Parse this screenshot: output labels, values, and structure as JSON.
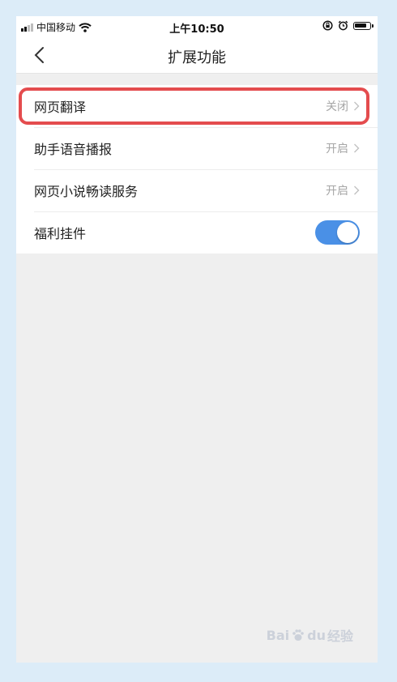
{
  "status_bar": {
    "carrier": "中国移动",
    "time": "上午10:50",
    "icons": [
      "signal-icon",
      "wifi-icon",
      "rotation-lock-icon",
      "alarm-icon",
      "battery-icon"
    ]
  },
  "nav": {
    "title": "扩展功能",
    "back_icon": "chevron-left-icon"
  },
  "settings": [
    {
      "label": "网页翻译",
      "value": "关闭",
      "type": "link"
    },
    {
      "label": "助手语音播报",
      "value": "开启",
      "type": "link"
    },
    {
      "label": "网页小说畅读服务",
      "value": "开启",
      "type": "link"
    },
    {
      "label": "福利挂件",
      "type": "toggle",
      "on": true
    }
  ],
  "watermark": {
    "brand": "Bai",
    "suffix": "du",
    "text": "经验"
  },
  "colors": {
    "accent": "#4a90e6",
    "highlight": "#e44c4e",
    "frame": "#dcecf8",
    "background": "#efefef"
  }
}
